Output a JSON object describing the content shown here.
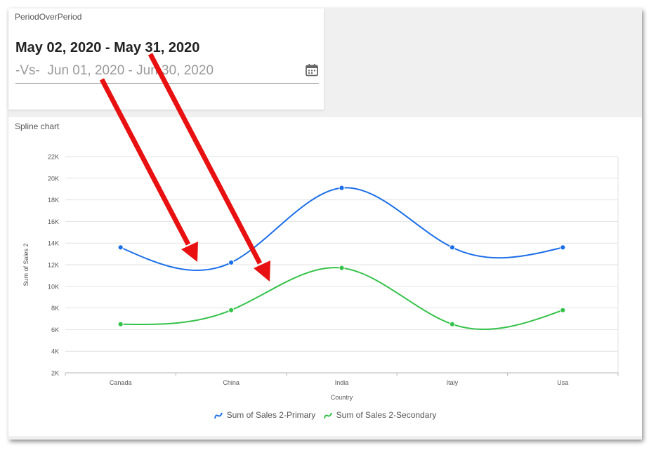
{
  "period_card": {
    "title": "PeriodOverPeriod",
    "primary_range": "May 02, 2020 - May 31, 2020",
    "compare_text": "-Vs-  Jun 01, 2020 - Jun 30, 2020",
    "calendar_icon": "calendar-icon"
  },
  "chart_card": {
    "title": "Spline chart"
  },
  "colors": {
    "primary": "#1a6ee8",
    "secondary": "#35c24a",
    "arrow": "#e81010",
    "grid": "#e2e2e2"
  },
  "chart_data": {
    "type": "line",
    "smooth": true,
    "categories": [
      "Canada",
      "China",
      "India",
      "Italy",
      "Usa"
    ],
    "xlabel": "Country",
    "ylabel": "Sum of Sales 2",
    "ylim": [
      2000,
      22000
    ],
    "yticks": [
      "2K",
      "4K",
      "6K",
      "8K",
      "10K",
      "12K",
      "14K",
      "16K",
      "18K",
      "20K",
      "22K"
    ],
    "grid": true,
    "legend_position": "bottom",
    "series": [
      {
        "name": "Sum of Sales 2-Primary",
        "values": [
          13600,
          12200,
          19100,
          13600,
          13600
        ]
      },
      {
        "name": "Sum of Sales 2-Secondary",
        "values": [
          6500,
          7800,
          11700,
          6500,
          7800
        ]
      }
    ]
  }
}
